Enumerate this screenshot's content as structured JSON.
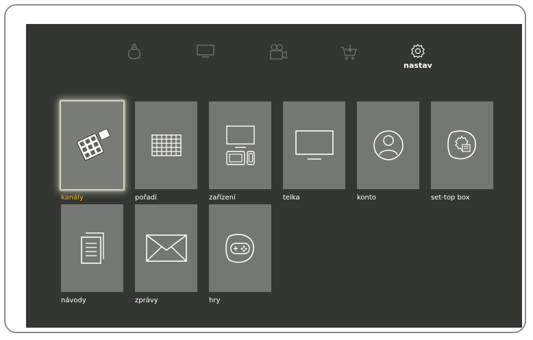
{
  "topnav": {
    "items": [
      {
        "icon": "hat-icon",
        "label": ""
      },
      {
        "icon": "tv-icon",
        "label": ""
      },
      {
        "icon": "camera-icon",
        "label": ""
      },
      {
        "icon": "cart-icon",
        "label": ""
      },
      {
        "icon": "gear-icon",
        "label": "nastav",
        "active": true
      }
    ]
  },
  "tiles": [
    {
      "label": "kanály",
      "icon": "channel-keypad-icon",
      "selected": true
    },
    {
      "label": "pořadí",
      "icon": "grid-icon"
    },
    {
      "label": "zařízení",
      "icon": "devices-icon"
    },
    {
      "label": "telka",
      "icon": "television-icon"
    },
    {
      "label": "konto",
      "icon": "user-icon"
    },
    {
      "label": "set-top box",
      "icon": "settop-box-icon"
    },
    {
      "label": "návody",
      "icon": "documents-icon"
    },
    {
      "label": "zprávy",
      "icon": "envelope-icon"
    },
    {
      "label": "hry",
      "icon": "gamepad-icon"
    }
  ],
  "colors": {
    "background": "#333631",
    "tile": "#757774",
    "selected_label": "#f0a830",
    "label": "#ffffff"
  }
}
